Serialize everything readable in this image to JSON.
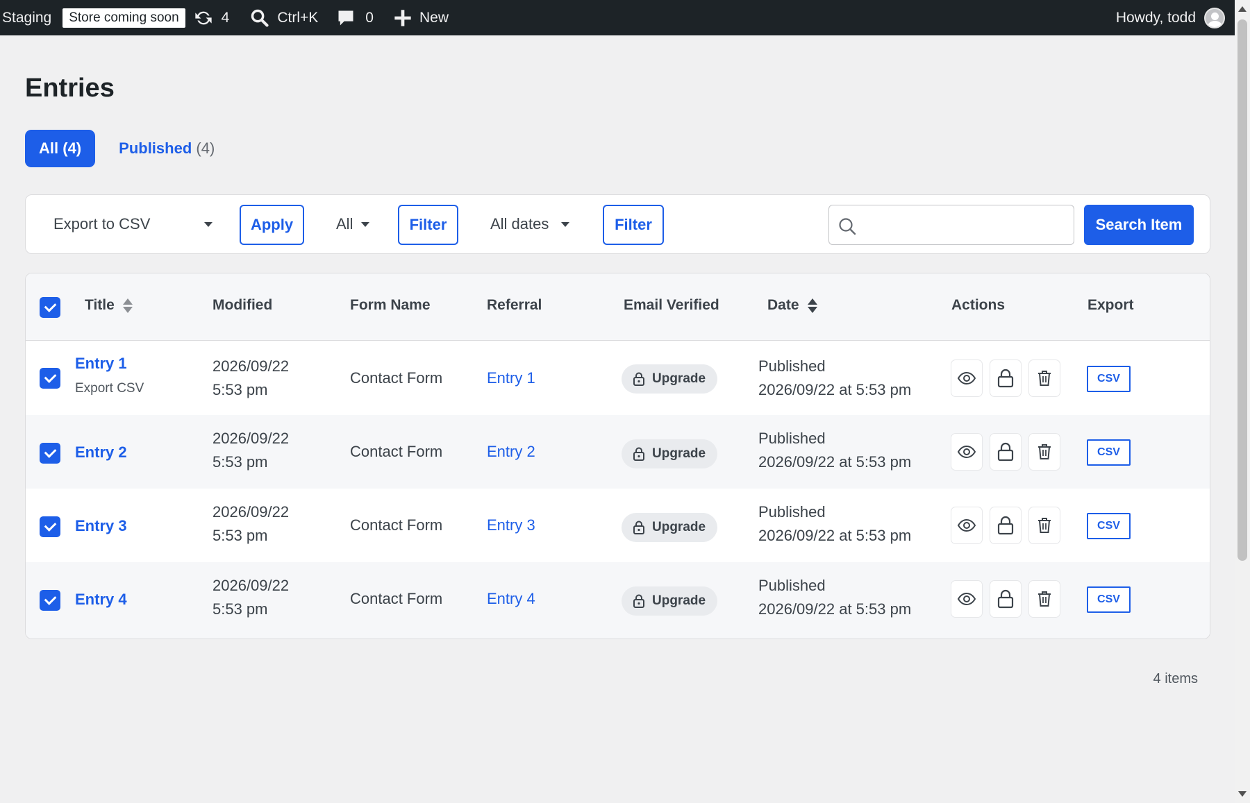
{
  "admin_bar": {
    "site_name": "Staging",
    "store_badge": "Store coming soon",
    "updates_count": "4",
    "search_shortcut": "Ctrl+K",
    "comments_count": "0",
    "new_label": "New",
    "greeting": "Howdy, todd"
  },
  "page": {
    "title": "Entries",
    "tabs": [
      {
        "label": "All",
        "count": "(4)",
        "active": true
      },
      {
        "label": "Published",
        "count": "(4)",
        "active": false
      }
    ]
  },
  "toolbar": {
    "bulk_action": "Export to CSV",
    "apply_label": "Apply",
    "status_filter": "All",
    "filter_label": "Filter",
    "date_filter": "All dates",
    "filter2_label": "Filter",
    "search_placeholder": "",
    "search_button": "Search Item"
  },
  "table": {
    "columns": [
      "Title",
      "Modified",
      "Form Name",
      "Referral",
      "Email Verified",
      "Date",
      "Actions",
      "Export"
    ],
    "rows": [
      {
        "title": "Entry 1",
        "row_action": "Export CSV",
        "modified_date": "2026/09/22",
        "modified_time": "5:53 pm",
        "form_name": "Contact Form",
        "referral": "Entry 1",
        "email_verified": "Upgrade",
        "status": "Published",
        "date": "2026/09/22 at 5:53 pm",
        "export": "CSV"
      },
      {
        "title": "Entry 2",
        "modified_date": "2026/09/22",
        "modified_time": "5:53 pm",
        "form_name": "Contact Form",
        "referral": "Entry 2",
        "email_verified": "Upgrade",
        "status": "Published",
        "date": "2026/09/22 at 5:53 pm",
        "export": "CSV"
      },
      {
        "title": "Entry 3",
        "modified_date": "2026/09/22",
        "modified_time": "5:53 pm",
        "form_name": "Contact Form",
        "referral": "Entry 3",
        "email_verified": "Upgrade",
        "status": "Published",
        "date": "2026/09/22 at 5:53 pm",
        "export": "CSV"
      },
      {
        "title": "Entry 4",
        "modified_date": "2026/09/22",
        "modified_time": "5:53 pm",
        "form_name": "Contact Form",
        "referral": "Entry 4",
        "email_verified": "Upgrade",
        "status": "Published",
        "date": "2026/09/22 at 5:53 pm",
        "export": "CSV"
      }
    ]
  },
  "footer": {
    "items_count": "4 items"
  },
  "colors": {
    "accent": "#1d5ee8",
    "admin_bar": "#1d2327",
    "background": "#f0f0f1"
  }
}
